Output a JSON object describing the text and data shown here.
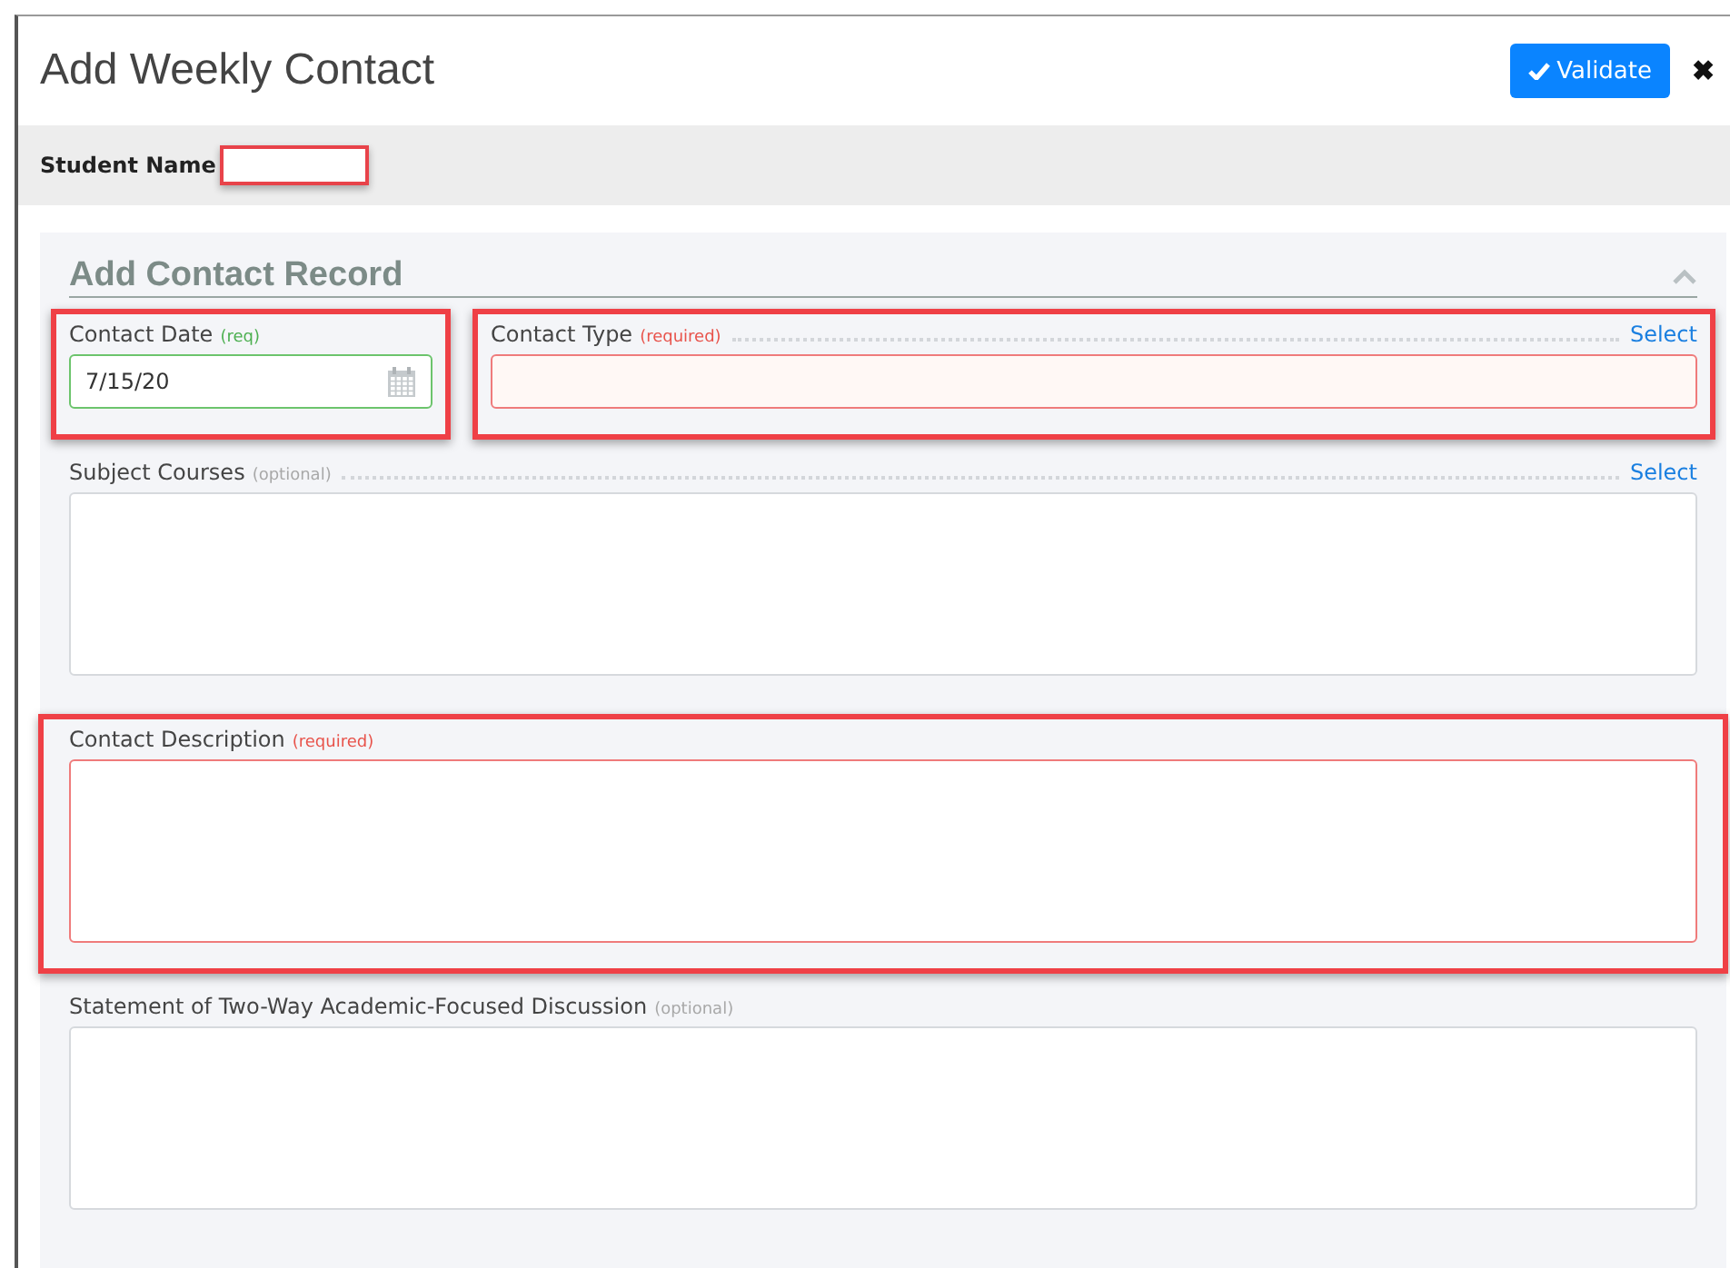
{
  "window": {
    "title": "Add Weekly Contact"
  },
  "header_actions": {
    "validate": "Validate",
    "close": "✖"
  },
  "student": {
    "label": "Student Name",
    "highlighted": true
  },
  "section": {
    "title": "Add Contact Record",
    "expanded": true
  },
  "fields": [
    {
      "kind": "date",
      "label": "Contact Date",
      "note": "(req)",
      "valid": true,
      "value": "7/15/20",
      "highlighted": true
    },
    {
      "kind": "select",
      "label": "Contact Type",
      "note": "(required)",
      "required": true,
      "valid": false,
      "action": "Select",
      "highlighted": true
    },
    {
      "kind": "select-area",
      "label": "Subject Courses",
      "note": "(optional)",
      "required": false,
      "valid": false,
      "action": "Select",
      "highlighted": false
    },
    {
      "kind": "textarea",
      "label": "Contact Description",
      "note": "(required)",
      "required": true,
      "valid": false,
      "highlighted": true
    },
    {
      "kind": "textarea",
      "label": "Statement of Two-Way Academic-Focused Discussion",
      "note": "(optional)",
      "required": false,
      "valid": false,
      "highlighted": false
    }
  ]
}
